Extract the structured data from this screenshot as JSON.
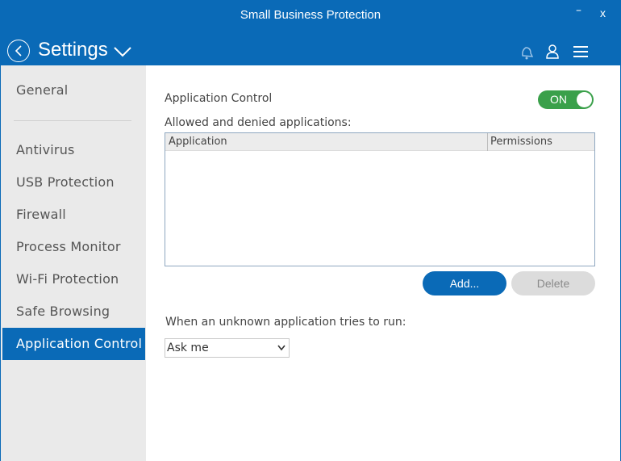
{
  "window": {
    "title": "Small Business Protection",
    "minimize_label": "–",
    "close_label": "x"
  },
  "header": {
    "title": "Settings",
    "icons": [
      "back-circle-icon",
      "chevron-down-icon",
      "bell-icon",
      "user-icon",
      "hamburger-menu-icon"
    ]
  },
  "sidebar": {
    "items": [
      {
        "label": "General",
        "active": false
      },
      {
        "label": "Antivirus",
        "active": false
      },
      {
        "label": "USB Protection",
        "active": false
      },
      {
        "label": "Firewall",
        "active": false
      },
      {
        "label": "Process Monitor",
        "active": false
      },
      {
        "label": "Wi-Fi Protection",
        "active": false
      },
      {
        "label": "Safe Browsing",
        "active": false
      },
      {
        "label": "Application Control",
        "active": true
      }
    ]
  },
  "main": {
    "section_label": "Application Control",
    "toggle_label": "ON",
    "toggle_state": true,
    "list_label": "Allowed and denied applications:",
    "table": {
      "columns": [
        "Application",
        "Permissions"
      ],
      "rows": []
    },
    "add_button": "Add...",
    "delete_button": "Delete",
    "unknown_label": "When an unknown application tries to run:",
    "unknown_select_value": "Ask me"
  },
  "colors": {
    "accent": "#0a6ab7",
    "toggle_on": "#3aa04a",
    "sidebar_bg": "#eaeaea"
  }
}
